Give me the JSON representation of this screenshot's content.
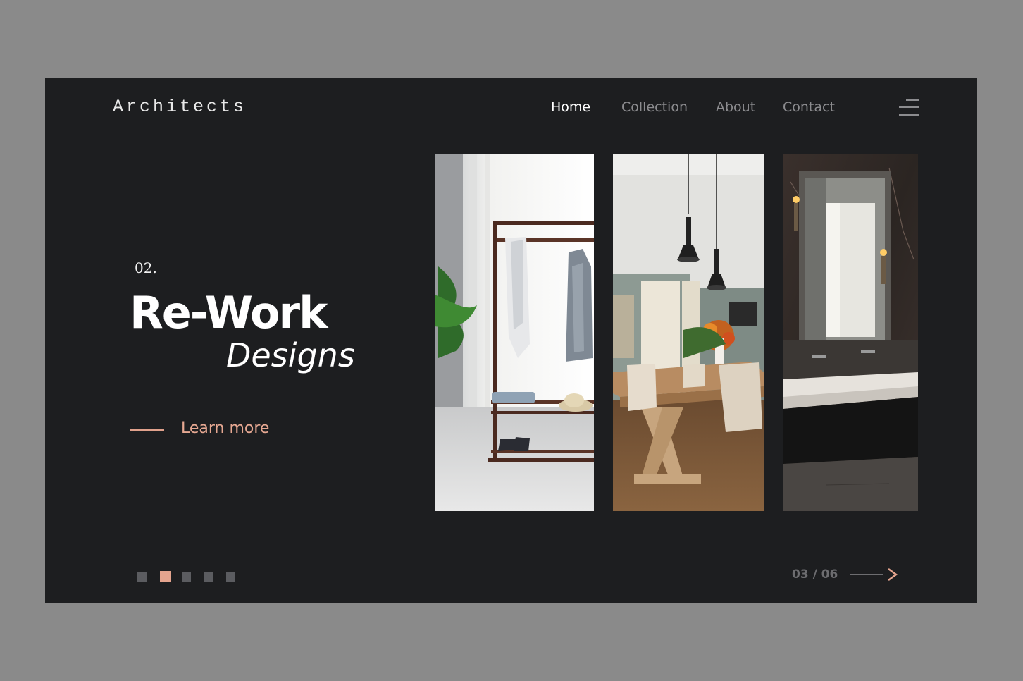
{
  "brand": {
    "logo": "Architects"
  },
  "nav": {
    "items": [
      {
        "label": "Home",
        "active": true
      },
      {
        "label": "Collection",
        "active": false
      },
      {
        "label": "About",
        "active": false
      },
      {
        "label": "Contact",
        "active": false
      }
    ],
    "menu_icon": "hamburger-menu-icon"
  },
  "hero": {
    "number": "02.",
    "title": "Re-Work",
    "subtitle": "Designs",
    "cta_label": "Learn more"
  },
  "gallery": [
    {
      "name": "clothes-rack-photo"
    },
    {
      "name": "dining-room-photo"
    },
    {
      "name": "bathroom-vanity-photo"
    }
  ],
  "pagination": {
    "dots_total": 5,
    "active_dot": 2,
    "counter": "03 / 06",
    "next_icon": "arrow-right-icon"
  },
  "colors": {
    "background": "#1d1e20",
    "outer": "#8a8a8a",
    "accent": "#e4a48e",
    "nav_inactive": "#8c8c8f",
    "text": "#ffffff"
  }
}
